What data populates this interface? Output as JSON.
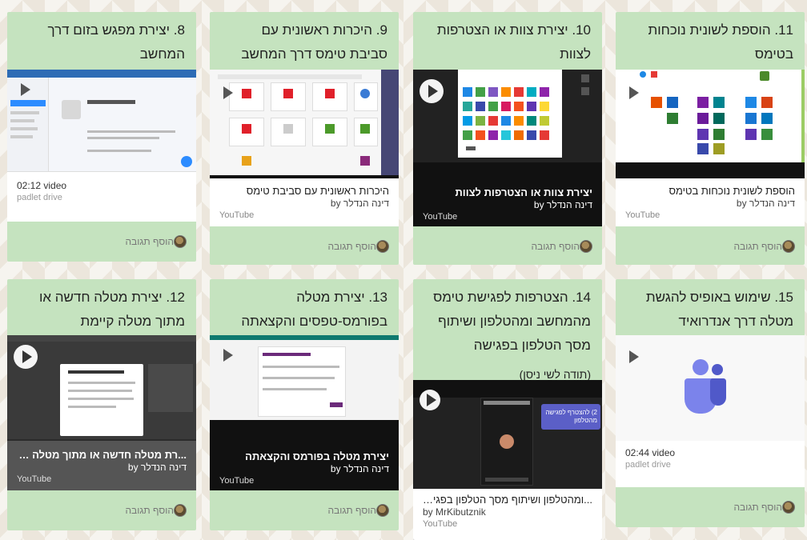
{
  "cards": [
    {
      "id": "c8",
      "title_lines": [
        "8. יצירת מפגש בזום דרך",
        "המחשב"
      ],
      "duration": "02:12 video",
      "source": "padlet drive",
      "comment_label": "הוסף תגובה"
    },
    {
      "id": "c9",
      "title_lines": [
        "9. היכרות ראשונית עם",
        "סביבת טימס דרך המחשב"
      ],
      "video_title": "היכרות ראשונית עם סביבת טימס",
      "by": "דינה הנדלר by",
      "source": "YouTube",
      "comment_label": "הוסף תגובה"
    },
    {
      "id": "c10",
      "title_lines": [
        "10. יצירת צוות או הצטרפות",
        "לצוות"
      ],
      "video_title": "יצירת צוות או הצטרפות לצוות",
      "by": "דינה הנדלר by",
      "source": "YouTube",
      "comment_label": "הוסף תגובה"
    },
    {
      "id": "c11",
      "title_lines": [
        "11. הוספת לשונית נוכחות",
        "בטימס"
      ],
      "video_title": "הוספת לשונית נוכחות בטימס",
      "by": "דינה הנדלר by",
      "source": "YouTube",
      "comment_label": "הוסף תגובה"
    },
    {
      "id": "c12",
      "title_lines": [
        "12. יצירת מטלה חדשה או",
        "מתוך מטלה קיימת"
      ],
      "video_title": "...רת מטלה חדשה או מתוך מטלה קיימת",
      "by": "דינה הנדלר by",
      "source": "YouTube",
      "comment_label": "הוסף תגובה"
    },
    {
      "id": "c13",
      "title_lines": [
        "13. יצירת מטלה",
        "בפורמס-טפסים והקצאתה"
      ],
      "video_title": "יצירת מטלה בפורמס והקצאתה",
      "by": "דינה הנדלר by",
      "source": "YouTube",
      "comment_label": "הוסף תגובה"
    },
    {
      "id": "c14",
      "title_lines": [
        "14. הצטרפות לפגישת טימס",
        "מהמחשב ומהטלפון ושיתוף",
        "מסך הטלפון בפגישה"
      ],
      "title_note": "(תודה לשי ניסן)",
      "thumb_overlay_text": "2) להצטרף לפגישה מהטלפון",
      "video_title": "...ומהטלפון ושיתוף מסך הטלפון בפגישה",
      "by": "by MrKibutznik",
      "source": "YouTube"
    },
    {
      "id": "c15",
      "title_lines": [
        "15. שימוש באופיס להגשת",
        "מטלה דרך אנדרואיד"
      ],
      "duration": "02:44 video",
      "source": "padlet drive",
      "comment_label": "הוסף תגובה"
    }
  ],
  "colors": {
    "header_green": "#c5e3bf",
    "background": "#ece6dc",
    "teams_purple": "#7b83eb"
  }
}
